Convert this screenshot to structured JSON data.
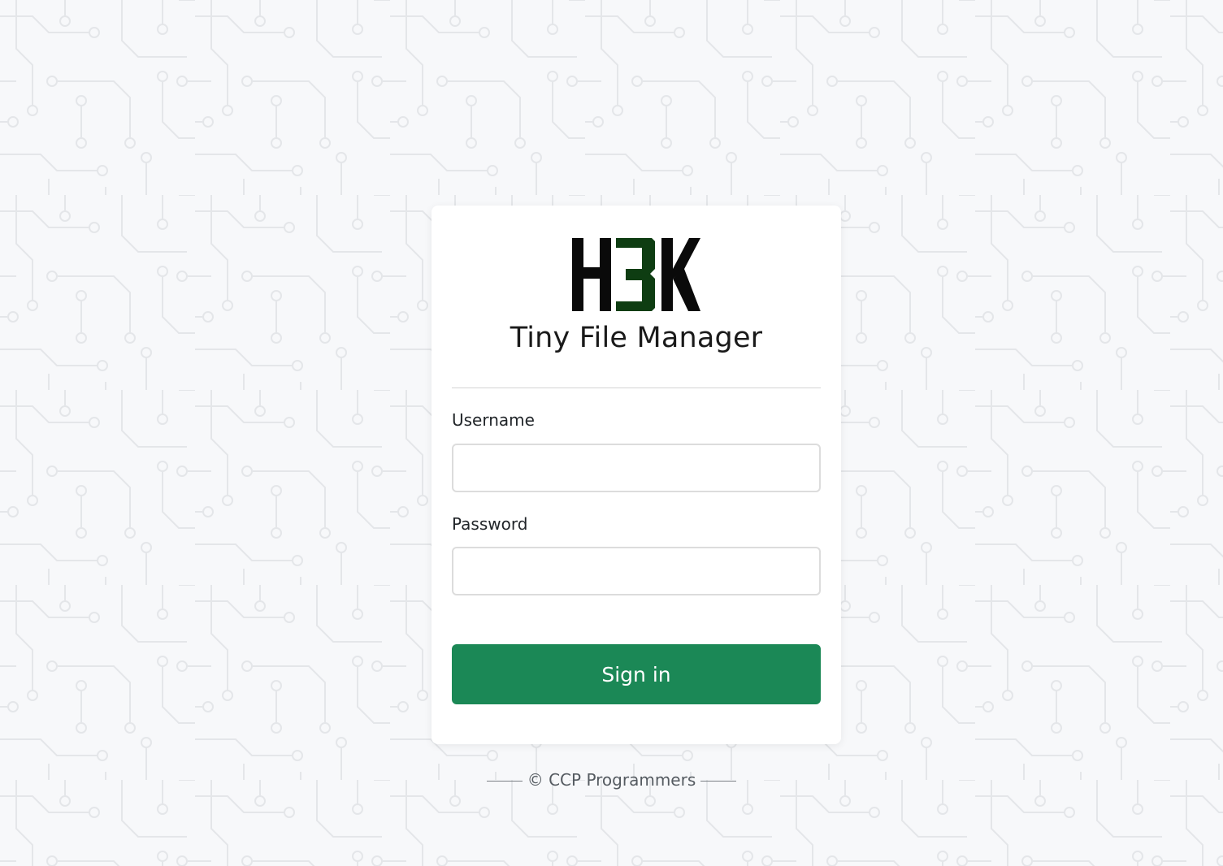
{
  "colors": {
    "background": "#f7f8fa",
    "pattern": "#e6e8eb",
    "card": "#ffffff",
    "accent": "#1b8856",
    "logo_dark": "#0a0a0a",
    "logo_green": "#0e3d12"
  },
  "logo": {
    "text": "H3K",
    "icon": "h3k-logo"
  },
  "app": {
    "title": "Tiny File Manager"
  },
  "form": {
    "username_label": "Username",
    "username_value": "",
    "username_placeholder": "",
    "password_label": "Password",
    "password_value": "",
    "password_placeholder": "",
    "signin_label": "Sign in"
  },
  "footer": {
    "text": "© CCP Programmers"
  }
}
